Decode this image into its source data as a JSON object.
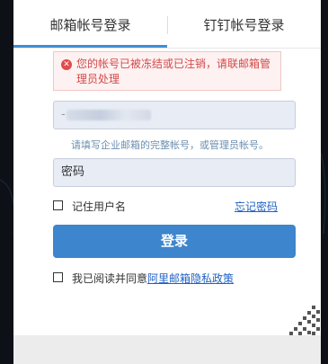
{
  "tabs": [
    {
      "label": "邮箱帐号登录",
      "active": true
    },
    {
      "label": "钉钉帐号登录",
      "active": false
    }
  ],
  "error": {
    "message": "您的帐号已被冻结或已注销，请联邮箱管理员处理"
  },
  "form": {
    "email_value": "-",
    "email_hint": "请填写企业邮箱的完整帐号，或管理员帐号。",
    "password_placeholder": "密码",
    "remember_label": "记住用户名",
    "forgot_label": "忘记密码",
    "login_label": "登录",
    "agree_prefix": "我已阅读并同意",
    "policy_label": "阿里邮箱隐私政策"
  },
  "colors": {
    "accent": "#3d85cc",
    "error": "#d44a4a",
    "link": "#1f62c4"
  }
}
